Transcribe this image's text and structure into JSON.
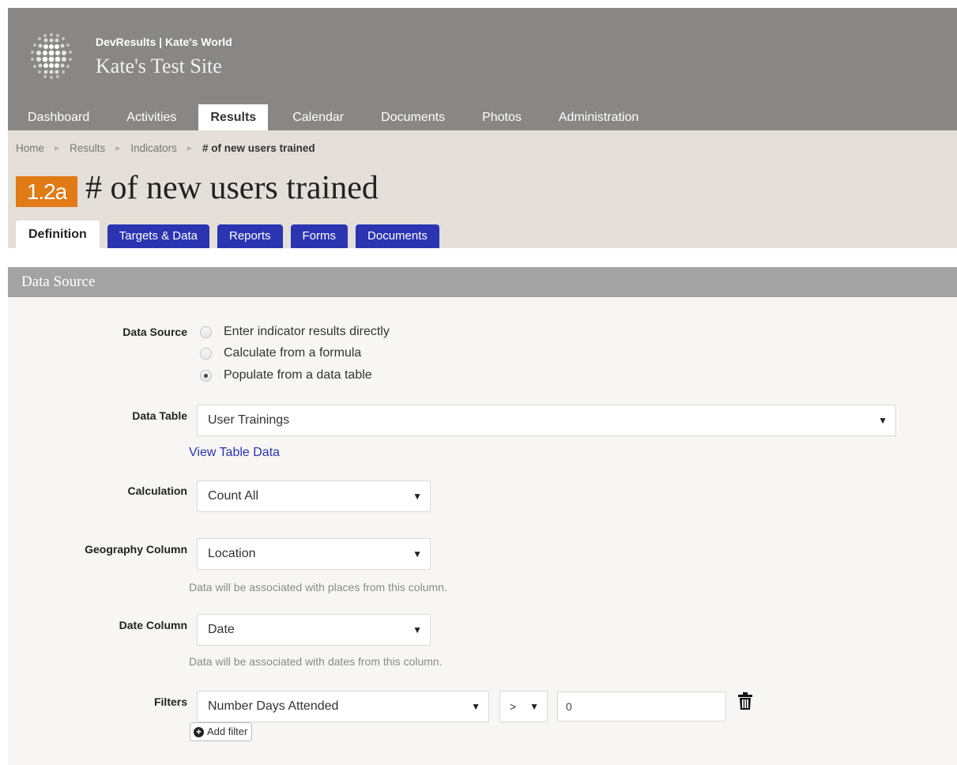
{
  "header": {
    "org_line": "DevResults | Kate's World",
    "site_title": "Kate's Test Site"
  },
  "nav": {
    "items": [
      "Dashboard",
      "Activities",
      "Results",
      "Calendar",
      "Documents",
      "Photos",
      "Administration"
    ],
    "active": "Results"
  },
  "breadcrumb": {
    "items": [
      "Home",
      "Results",
      "Indicators"
    ],
    "current": "# of new users trained"
  },
  "indicator": {
    "code": "1.2a",
    "title": "# of new users trained"
  },
  "tabs": {
    "items": [
      "Definition",
      "Targets & Data",
      "Reports",
      "Forms",
      "Documents"
    ],
    "active": "Definition"
  },
  "section": {
    "title": "Data Source"
  },
  "form": {
    "data_source": {
      "label": "Data Source",
      "options": [
        "Enter indicator results directly",
        "Calculate from a formula",
        "Populate from a data table"
      ],
      "selected": "Populate from a data table"
    },
    "data_table": {
      "label": "Data Table",
      "value": "User Trainings",
      "link": "View Table Data"
    },
    "calculation": {
      "label": "Calculation",
      "value": "Count All"
    },
    "geography_column": {
      "label": "Geography Column",
      "value": "Location",
      "hint": "Data will be associated with places from this column."
    },
    "date_column": {
      "label": "Date Column",
      "value": "Date",
      "hint": "Data will be associated with dates from this column."
    },
    "filters": {
      "label": "Filters",
      "column": "Number Days Attended",
      "operator": ">",
      "value": "0",
      "add_label": "Add filter"
    }
  },
  "colors": {
    "header_bg": "#888786",
    "title_band_bg": "#e4dfd9",
    "badge": "#e07b16",
    "tab_blue": "#2b34b1",
    "section_head": "#a3a3a3",
    "form_bg": "#f7f6f4"
  },
  "icons": [
    "logo-globe-icon",
    "breadcrumb-arrow-icon",
    "radio-icon",
    "dropdown-caret-icon",
    "trash-icon",
    "plus-circle-icon"
  ]
}
